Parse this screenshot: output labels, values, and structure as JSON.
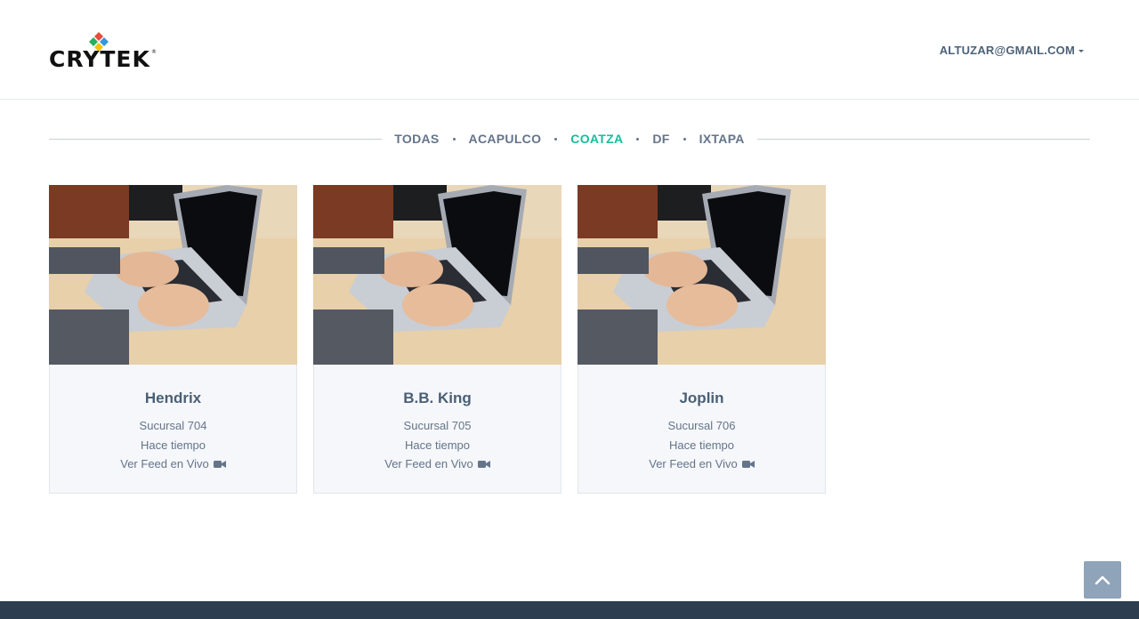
{
  "header": {
    "logo_alt": "CRYTEK",
    "user_email": "ALTUZAR@GMAIL.COM"
  },
  "filters": {
    "items": [
      {
        "label": "TODAS",
        "active": false
      },
      {
        "label": "ACAPULCO",
        "active": false
      },
      {
        "label": "COATZA",
        "active": true
      },
      {
        "label": "DF",
        "active": false
      },
      {
        "label": "IXTAPA",
        "active": false
      }
    ]
  },
  "cards": [
    {
      "title": "Hendrix",
      "branch": "Sucursal 704",
      "time": "Hace tiempo",
      "link": "Ver Feed en Vivo",
      "link_icon": "video-camera-icon"
    },
    {
      "title": "B.B. King",
      "branch": "Sucursal 705",
      "time": "Hace tiempo",
      "link": "Ver Feed en Vivo",
      "link_icon": "video-camera-icon"
    },
    {
      "title": "Joplin",
      "branch": "Sucursal 706",
      "time": "Hace tiempo",
      "link": "Ver Feed en Vivo",
      "link_icon": "video-camera-icon"
    }
  ],
  "colors": {
    "accent": "#1abc9c",
    "text": "#64748a",
    "footer": "#2c3e50",
    "to_top_button": "#8fa3b9"
  },
  "icons": {
    "scroll_top": "chevron-up-icon",
    "user_menu": "caret-down-icon"
  }
}
